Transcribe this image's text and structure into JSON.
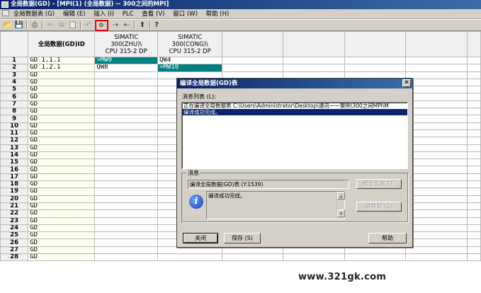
{
  "window": {
    "title": "全局数据(GD) - [MPI(1) (全局数据) -- 300之间的MPI]"
  },
  "menu": {
    "items": [
      "全局数据表 (G)",
      "编辑 (E)",
      "插入 (I)",
      "PLC",
      "查看 (V)",
      "窗口 (W)",
      "帮助 (H)"
    ]
  },
  "toolbar": {
    "icons": [
      "open-folder-icon",
      "save-icon",
      "print-icon",
      "cut-icon",
      "copy-icon",
      "paste-icon",
      "undo-icon",
      "compile-icon",
      "send-icon",
      "receive-icon",
      "download-icon",
      "help-icon"
    ]
  },
  "grid": {
    "header": {
      "id": "全局数据(GD)ID",
      "col1": "SIMATIC\n300(ZHU)\\\nCPU 315-2 DP",
      "col2": "SIMATIC\n300(CONG)\\\nCPU 315-2 DP"
    },
    "rows": [
      {
        "n": "1",
        "id": "GD  1.1.1",
        "c1": ">MW0",
        "c2": "QW4"
      },
      {
        "n": "2",
        "id": "GD  1.2.1",
        "c1": "QW8",
        "c2": ">MW10"
      },
      {
        "n": "3",
        "id": "GD",
        "c1": "",
        "c2": ""
      },
      {
        "n": "4",
        "id": "GD",
        "c1": "",
        "c2": ""
      },
      {
        "n": "5",
        "id": "GD",
        "c1": "",
        "c2": ""
      },
      {
        "n": "6",
        "id": "GD",
        "c1": "",
        "c2": ""
      },
      {
        "n": "7",
        "id": "GD",
        "c1": "",
        "c2": ""
      },
      {
        "n": "8",
        "id": "GD",
        "c1": "",
        "c2": ""
      },
      {
        "n": "9",
        "id": "GD",
        "c1": "",
        "c2": ""
      },
      {
        "n": "10",
        "id": "GD",
        "c1": "",
        "c2": ""
      },
      {
        "n": "11",
        "id": "GD",
        "c1": "",
        "c2": ""
      },
      {
        "n": "12",
        "id": "GD",
        "c1": "",
        "c2": ""
      },
      {
        "n": "13",
        "id": "GD",
        "c1": "",
        "c2": ""
      },
      {
        "n": "14",
        "id": "GD",
        "c1": "",
        "c2": ""
      },
      {
        "n": "15",
        "id": "GD",
        "c1": "",
        "c2": ""
      },
      {
        "n": "16",
        "id": "GD",
        "c1": "",
        "c2": ""
      },
      {
        "n": "17",
        "id": "GD",
        "c1": "",
        "c2": ""
      },
      {
        "n": "18",
        "id": "GD",
        "c1": "",
        "c2": ""
      },
      {
        "n": "19",
        "id": "GD",
        "c1": "",
        "c2": ""
      },
      {
        "n": "20",
        "id": "GD",
        "c1": "",
        "c2": ""
      },
      {
        "n": "21",
        "id": "GD",
        "c1": "",
        "c2": ""
      },
      {
        "n": "22",
        "id": "GD",
        "c1": "",
        "c2": ""
      },
      {
        "n": "23",
        "id": "GD",
        "c1": "",
        "c2": ""
      },
      {
        "n": "24",
        "id": "GD",
        "c1": "",
        "c2": ""
      },
      {
        "n": "25",
        "id": "GD",
        "c1": "",
        "c2": ""
      },
      {
        "n": "26",
        "id": "GD",
        "c1": "",
        "c2": ""
      },
      {
        "n": "27",
        "id": "GD",
        "c1": "",
        "c2": ""
      },
      {
        "n": "28",
        "id": "GD",
        "c1": "",
        "c2": ""
      }
    ],
    "selected_color": "#008080"
  },
  "dialog": {
    "title": "编译全局数据(GD)表",
    "close_glyph": "✕",
    "msglist_label": "消息列表 (L):",
    "msglist": [
      "正在编译全局数据表 C:\\Users\\Administrator\\Desktop\\通讯一一案例\\300之间MPI\\M",
      "编译成功完成。"
    ],
    "group_label": "消息",
    "message_field": "编译全局数据(GD)表      (Y:1539)",
    "help_text_button": "帮助文本 (T)",
    "info_text": "编译成功完成。",
    "goto_button": "跳转到 (G)",
    "close_button": "关闭",
    "save_button": "保存 (S)",
    "help_button": "帮助"
  },
  "watermark": "www.321gk.com"
}
